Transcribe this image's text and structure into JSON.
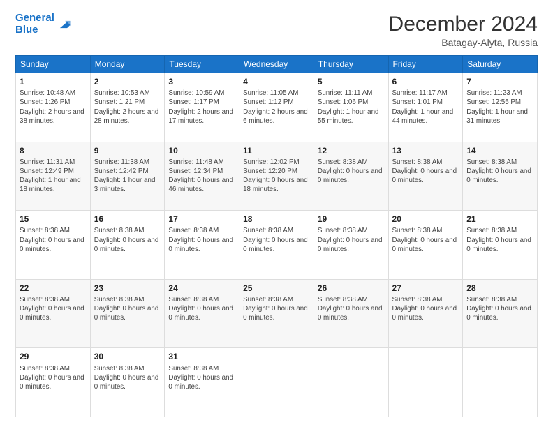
{
  "header": {
    "logo_line1": "General",
    "logo_line2": "Blue",
    "title": "December 2024",
    "subtitle": "Batagay-Alyta, Russia"
  },
  "days_of_week": [
    "Sunday",
    "Monday",
    "Tuesday",
    "Wednesday",
    "Thursday",
    "Friday",
    "Saturday"
  ],
  "weeks": [
    [
      {
        "day": "1",
        "info": "Sunrise: 10:48 AM\nSunset: 1:26 PM\nDaylight: 2 hours and 38 minutes."
      },
      {
        "day": "2",
        "info": "Sunrise: 10:53 AM\nSunset: 1:21 PM\nDaylight: 2 hours and 28 minutes."
      },
      {
        "day": "3",
        "info": "Sunrise: 10:59 AM\nSunset: 1:17 PM\nDaylight: 2 hours and 17 minutes."
      },
      {
        "day": "4",
        "info": "Sunrise: 11:05 AM\nSunset: 1:12 PM\nDaylight: 2 hours and 6 minutes."
      },
      {
        "day": "5",
        "info": "Sunrise: 11:11 AM\nSunset: 1:06 PM\nDaylight: 1 hour and 55 minutes."
      },
      {
        "day": "6",
        "info": "Sunrise: 11:17 AM\nSunset: 1:01 PM\nDaylight: 1 hour and 44 minutes."
      },
      {
        "day": "7",
        "info": "Sunrise: 11:23 AM\nSunset: 12:55 PM\nDaylight: 1 hour and 31 minutes."
      }
    ],
    [
      {
        "day": "8",
        "info": "Sunrise: 11:31 AM\nSunset: 12:49 PM\nDaylight: 1 hour and 18 minutes."
      },
      {
        "day": "9",
        "info": "Sunrise: 11:38 AM\nSunset: 12:42 PM\nDaylight: 1 hour and 3 minutes."
      },
      {
        "day": "10",
        "info": "Sunrise: 11:48 AM\nSunset: 12:34 PM\nDaylight: 0 hours and 46 minutes."
      },
      {
        "day": "11",
        "info": "Sunrise: 12:02 PM\nSunset: 12:20 PM\nDaylight: 0 hours and 18 minutes."
      },
      {
        "day": "12",
        "info": "Sunset: 8:38 AM\nDaylight: 0 hours and 0 minutes."
      },
      {
        "day": "13",
        "info": "Sunset: 8:38 AM\nDaylight: 0 hours and 0 minutes."
      },
      {
        "day": "14",
        "info": "Sunset: 8:38 AM\nDaylight: 0 hours and 0 minutes."
      }
    ],
    [
      {
        "day": "15",
        "info": "Sunset: 8:38 AM\nDaylight: 0 hours and 0 minutes."
      },
      {
        "day": "16",
        "info": "Sunset: 8:38 AM\nDaylight: 0 hours and 0 minutes."
      },
      {
        "day": "17",
        "info": "Sunset: 8:38 AM\nDaylight: 0 hours and 0 minutes."
      },
      {
        "day": "18",
        "info": "Sunset: 8:38 AM\nDaylight: 0 hours and 0 minutes."
      },
      {
        "day": "19",
        "info": "Sunset: 8:38 AM\nDaylight: 0 hours and 0 minutes."
      },
      {
        "day": "20",
        "info": "Sunset: 8:38 AM\nDaylight: 0 hours and 0 minutes."
      },
      {
        "day": "21",
        "info": "Sunset: 8:38 AM\nDaylight: 0 hours and 0 minutes."
      }
    ],
    [
      {
        "day": "22",
        "info": "Sunset: 8:38 AM\nDaylight: 0 hours and 0 minutes."
      },
      {
        "day": "23",
        "info": "Sunset: 8:38 AM\nDaylight: 0 hours and 0 minutes."
      },
      {
        "day": "24",
        "info": "Sunset: 8:38 AM\nDaylight: 0 hours and 0 minutes."
      },
      {
        "day": "25",
        "info": "Sunset: 8:38 AM\nDaylight: 0 hours and 0 minutes."
      },
      {
        "day": "26",
        "info": "Sunset: 8:38 AM\nDaylight: 0 hours and 0 minutes."
      },
      {
        "day": "27",
        "info": "Sunset: 8:38 AM\nDaylight: 0 hours and 0 minutes."
      },
      {
        "day": "28",
        "info": "Sunset: 8:38 AM\nDaylight: 0 hours and 0 minutes."
      }
    ],
    [
      {
        "day": "29",
        "info": "Sunset: 8:38 AM\nDaylight: 0 hours and 0 minutes."
      },
      {
        "day": "30",
        "info": "Sunset: 8:38 AM\nDaylight: 0 hours and 0 minutes."
      },
      {
        "day": "31",
        "info": "Sunset: 8:38 AM\nDaylight: 0 hours and 0 minutes."
      },
      {
        "day": "",
        "info": ""
      },
      {
        "day": "",
        "info": ""
      },
      {
        "day": "",
        "info": ""
      },
      {
        "day": "",
        "info": ""
      }
    ]
  ]
}
